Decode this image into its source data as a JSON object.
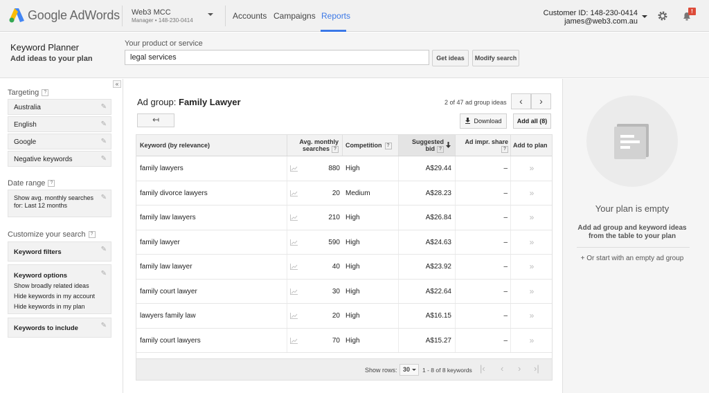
{
  "header": {
    "logo_text": "Google AdWords",
    "account_name": "Web3 MCC",
    "account_sub": "Manager • 148-230-0414",
    "nav": [
      "Accounts",
      "Campaigns",
      "Reports"
    ],
    "active_nav": "Reports",
    "customer_id": "Customer ID: 148-230-0414",
    "email": "james@web3.com.au",
    "notification_badge": "!"
  },
  "subheader": {
    "title": "Keyword Planner",
    "subtitle": "Add ideas to your plan",
    "product_label": "Your product or service",
    "product_value": "legal services",
    "get_ideas": "Get ideas",
    "modify_search": "Modify search"
  },
  "left": {
    "collapse": "«",
    "targeting_label": "Targeting",
    "targeting": [
      "Australia",
      "English",
      "Google",
      "Negative keywords"
    ],
    "date_range_label": "Date range",
    "date_range_value": "Show avg. monthly searches for: Last 12 months",
    "customize_label": "Customize your search",
    "keyword_filters": "Keyword filters",
    "keyword_options_title": "Keyword options",
    "keyword_options": [
      "Show broadly related ideas",
      "Hide keywords in my account",
      "Hide keywords in my plan"
    ],
    "keywords_to_include": "Keywords to include"
  },
  "main": {
    "adgroup_prefix": "Ad group:",
    "adgroup_name": "Family Lawyer",
    "ideas_count": "2 of 47 ad group ideas",
    "download": "Download",
    "add_all": "Add all (8)",
    "columns": {
      "keyword": "Keyword (by relevance)",
      "avg_line1": "Avg. monthly",
      "avg_line2": "searches",
      "competition": "Competition",
      "bid_line1": "Suggested",
      "bid_line2": "bid",
      "impr": "Ad impr. share",
      "add": "Add to plan"
    },
    "rows": [
      {
        "keyword": "family lawyers",
        "searches": "880",
        "competition": "High",
        "bid": "A$29.44",
        "impr": "–"
      },
      {
        "keyword": "family divorce lawyers",
        "searches": "20",
        "competition": "Medium",
        "bid": "A$28.23",
        "impr": "–"
      },
      {
        "keyword": "family law lawyers",
        "searches": "210",
        "competition": "High",
        "bid": "A$26.84",
        "impr": "–"
      },
      {
        "keyword": "family lawyer",
        "searches": "590",
        "competition": "High",
        "bid": "A$24.63",
        "impr": "–"
      },
      {
        "keyword": "family law lawyer",
        "searches": "40",
        "competition": "High",
        "bid": "A$23.92",
        "impr": "–"
      },
      {
        "keyword": "family court lawyer",
        "searches": "30",
        "competition": "High",
        "bid": "A$22.64",
        "impr": "–"
      },
      {
        "keyword": "lawyers family law",
        "searches": "20",
        "competition": "High",
        "bid": "A$16.15",
        "impr": "–"
      },
      {
        "keyword": "family court lawyers",
        "searches": "70",
        "competition": "High",
        "bid": "A$15.27",
        "impr": "–"
      }
    ],
    "footer": {
      "show_rows_label": "Show rows:",
      "show_rows_value": "30",
      "range": "1 - 8 of 8 keywords"
    }
  },
  "plan": {
    "title": "Your plan is empty",
    "subtitle": "Add ad group and keyword ideas from the table to your plan",
    "link": "+ Or start with an empty ad group"
  },
  "colors": {
    "accent": "#3b78e7",
    "badge": "#dd4b39"
  }
}
